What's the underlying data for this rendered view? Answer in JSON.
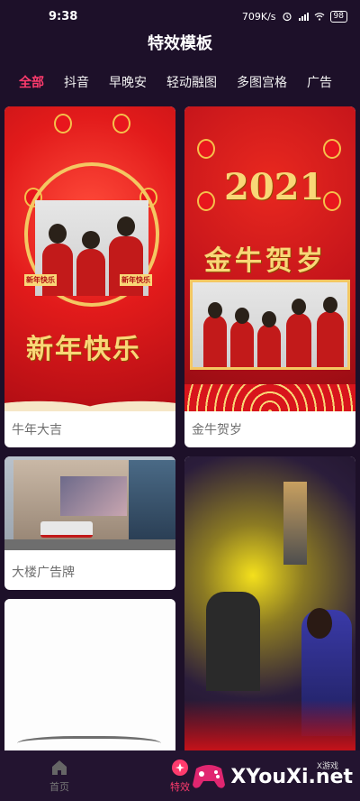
{
  "status_bar": {
    "time": "9:38",
    "network_speed": "709K/s",
    "battery": "98",
    "icons": [
      "alarm-icon",
      "signal-icon",
      "wifi-icon",
      "battery-icon"
    ]
  },
  "header": {
    "title": "特效模板"
  },
  "tabs": [
    {
      "label": "全部",
      "active": true
    },
    {
      "label": "抖音"
    },
    {
      "label": "早晚安"
    },
    {
      "label": "轻动融图"
    },
    {
      "label": "多图宫格"
    },
    {
      "label": "广告"
    }
  ],
  "cards": [
    {
      "caption": "牛年大吉",
      "thumb_text": "新年快乐",
      "seal_left": "新年快乐",
      "seal_right": "新年快乐"
    },
    {
      "caption": "金牛贺岁",
      "thumb_year": "2021",
      "thumb_text": "金牛贺岁"
    },
    {
      "caption": "大楼广告牌"
    },
    {
      "caption": ""
    },
    {
      "caption": ""
    }
  ],
  "bottom_nav": {
    "items": [
      {
        "label": "首页",
        "icon": "home-icon"
      },
      {
        "label": "特效",
        "icon": "effects-icon",
        "active": true
      }
    ]
  },
  "watermark": {
    "text": "XYouXi.net",
    "small": "X游戏"
  },
  "colors": {
    "accent": "#ff3b6d",
    "background": "#1d1029"
  }
}
